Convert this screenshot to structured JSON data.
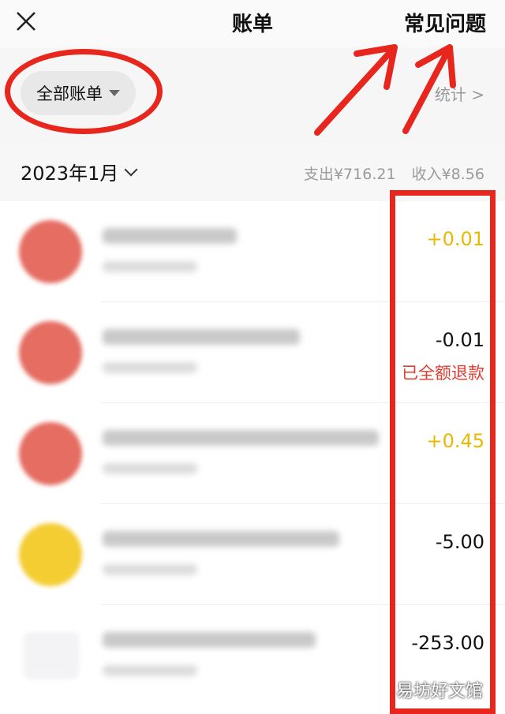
{
  "header": {
    "title": "账单",
    "faq_label": "常见问题"
  },
  "filter": {
    "label": "全部账单",
    "stats_label": "统计 >"
  },
  "month": {
    "label": "2023年1月",
    "expense": "支出¥716.21",
    "income": "收入¥8.56"
  },
  "transactions": [
    {
      "amount": "+0.01",
      "type": "pos",
      "note": ""
    },
    {
      "amount": "-0.01",
      "type": "neg",
      "note": "已全额退款"
    },
    {
      "amount": "+0.45",
      "type": "pos",
      "note": ""
    },
    {
      "amount": "-5.00",
      "type": "neg",
      "note": ""
    },
    {
      "amount": "-253.00",
      "type": "neg",
      "note": ""
    }
  ],
  "watermark": "易坊好文馆",
  "colors": {
    "annotation_red": "#e7261e",
    "income_yellow": "#e9b800",
    "refund_red": "#e23b2e"
  },
  "icons": {
    "close": "close-icon",
    "filter_caret": "caret-down-icon",
    "month_chevron": "chevron-down-icon"
  }
}
